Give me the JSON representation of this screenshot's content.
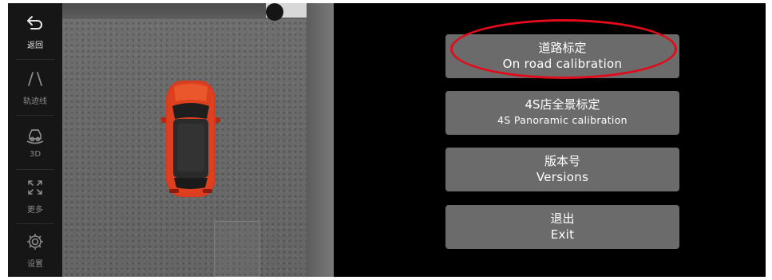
{
  "sidebar": {
    "items": [
      {
        "label": "返回",
        "icon": "back-arrow-icon"
      },
      {
        "label": "轨迹线",
        "icon": "trajectory-lines-icon"
      },
      {
        "label": "3D",
        "icon": "3d-car-icon"
      },
      {
        "label": "更多",
        "icon": "expand-icon"
      },
      {
        "label": "设置",
        "icon": "gear-icon"
      }
    ]
  },
  "camera": {
    "view": "top-down surround view",
    "car_color": "#d93a1e"
  },
  "menu": {
    "items": [
      {
        "zh": "道路标定",
        "en": "On road calibration",
        "highlighted": true
      },
      {
        "zh": "4S店全景标定",
        "en": "4S Panoramic calibration",
        "highlighted": false
      },
      {
        "zh": "版本号",
        "en": "Versions",
        "highlighted": false
      },
      {
        "zh": "退出",
        "en": "Exit",
        "highlighted": false
      }
    ]
  },
  "colors": {
    "button_bg": "#6b6b6b",
    "highlight": "#e10b1b",
    "background": "#000000"
  }
}
